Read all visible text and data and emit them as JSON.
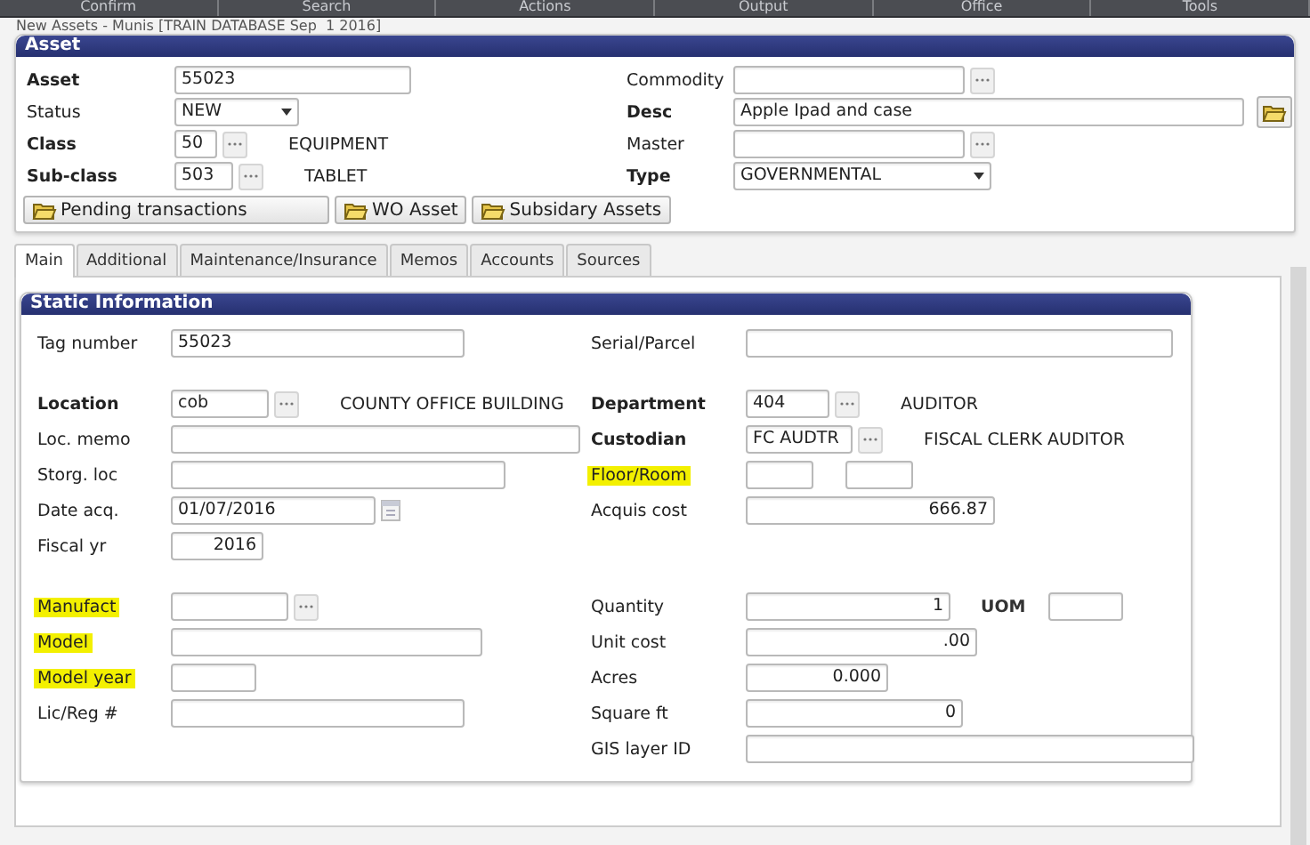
{
  "menu_bar": {
    "items": [
      {
        "label": "Confirm"
      },
      {
        "label": "Search"
      },
      {
        "label": "Actions"
      },
      {
        "label": "Output"
      },
      {
        "label": "Office"
      },
      {
        "label": "Tools"
      }
    ]
  },
  "window": {
    "title": "New Assets - Munis [TRAIN DATABASE Sep  1 2016]"
  },
  "asset_panel": {
    "title": "Asset",
    "rows": [
      {
        "left": {
          "label": "Asset",
          "bold": true,
          "highlighted": false,
          "kind": "text",
          "value": "55023"
        },
        "right": {
          "label": "Commodity",
          "bold": false,
          "highlighted": false,
          "kind": "lookup"
        }
      },
      {
        "left": {
          "label": "Status",
          "bold": false,
          "highlighted": false,
          "kind": "select",
          "value": "NEW"
        },
        "right": {
          "label": "Desc",
          "bold": true,
          "highlighted": false,
          "kind": "text_attach",
          "value": "Apple Ipad and case"
        }
      },
      {
        "left": {
          "label": "Class",
          "bold": true,
          "highlighted": false,
          "kind": "lookup",
          "value": "50",
          "description": "EQUIPMENT"
        },
        "right": {
          "label": "Master",
          "bold": false,
          "highlighted": false,
          "kind": "lookup"
        }
      },
      {
        "left": {
          "label": "Sub-class",
          "bold": true,
          "highlighted": false,
          "kind": "lookup",
          "value": "503",
          "description": "TABLET"
        },
        "right": {
          "label": "Type",
          "bold": true,
          "highlighted": false,
          "kind": "select",
          "value": "GOVERNMENTAL"
        }
      }
    ],
    "buttons": [
      {
        "label": "Pending transactions"
      },
      {
        "label": "WO Asset"
      },
      {
        "label": "Subsidary Assets"
      }
    ]
  },
  "tabs": [
    {
      "label": "Main",
      "selected": true
    },
    {
      "label": "Additional",
      "selected": false
    },
    {
      "label": "Maintenance/Insurance",
      "selected": false
    },
    {
      "label": "Memos",
      "selected": false
    },
    {
      "label": "Accounts",
      "selected": false
    },
    {
      "label": "Sources",
      "selected": false
    }
  ],
  "static_panel": {
    "title": "Static Information",
    "rows": [
      {
        "left": {
          "label": "Tag number",
          "bold": false,
          "highlighted": false,
          "kind": "text",
          "value": "55023"
        },
        "right": {
          "label": "Serial/Parcel",
          "bold": false,
          "highlighted": false,
          "kind": "text"
        }
      },
      {
        "left": {
          "label": "Location",
          "bold": true,
          "highlighted": false,
          "kind": "lookup",
          "value": "cob",
          "description": "COUNTY OFFICE BUILDING"
        },
        "right": {
          "label": "Department",
          "bold": true,
          "highlighted": false,
          "kind": "lookup",
          "value": "404",
          "description": "AUDITOR"
        }
      },
      {
        "left": {
          "label": "Loc. memo",
          "bold": false,
          "highlighted": false,
          "kind": "text"
        },
        "right": {
          "label": "Custodian",
          "bold": true,
          "highlighted": false,
          "kind": "lookup",
          "value": "FC AUDTR",
          "description": "FISCAL CLERK AUDITOR"
        }
      },
      {
        "left": {
          "label": "Storg. loc",
          "bold": false,
          "highlighted": false,
          "kind": "text"
        },
        "right": {
          "label": "Floor/Room",
          "bold": false,
          "highlighted": true,
          "kind": "pair"
        }
      },
      {
        "left": {
          "label": "Date acq.",
          "bold": false,
          "highlighted": false,
          "kind": "date",
          "value": "01/07/2016"
        },
        "right": {
          "label": "Acquis cost",
          "bold": false,
          "highlighted": false,
          "kind": "number",
          "value": "666.87"
        }
      },
      {
        "left": {
          "label": "Fiscal yr",
          "bold": false,
          "highlighted": false,
          "kind": "number",
          "value": "2016"
        }
      },
      {
        "left": {
          "label": "Manufact",
          "bold": false,
          "highlighted": true,
          "kind": "lookup"
        },
        "right": {
          "label": "Quantity",
          "bold": false,
          "highlighted": false,
          "kind": "number_unit",
          "value": "1",
          "unit_label": "UOM"
        }
      },
      {
        "left": {
          "label": "Model",
          "bold": false,
          "highlighted": true,
          "kind": "text"
        },
        "right": {
          "label": "Unit cost",
          "bold": false,
          "highlighted": false,
          "kind": "number",
          "value": ".00"
        }
      },
      {
        "left": {
          "label": "Model year",
          "bold": false,
          "highlighted": true,
          "kind": "text"
        },
        "right": {
          "label": "Acres",
          "bold": false,
          "highlighted": false,
          "kind": "number",
          "value": "0.000"
        }
      },
      {
        "left": {
          "label": "Lic/Reg #",
          "bold": false,
          "highlighted": false,
          "kind": "text"
        },
        "right": {
          "label": "Square ft",
          "bold": false,
          "highlighted": false,
          "kind": "number",
          "value": "0"
        }
      },
      {
        "right": {
          "label": "GIS layer ID",
          "bold": false,
          "highlighted": false,
          "kind": "text"
        }
      }
    ]
  }
}
